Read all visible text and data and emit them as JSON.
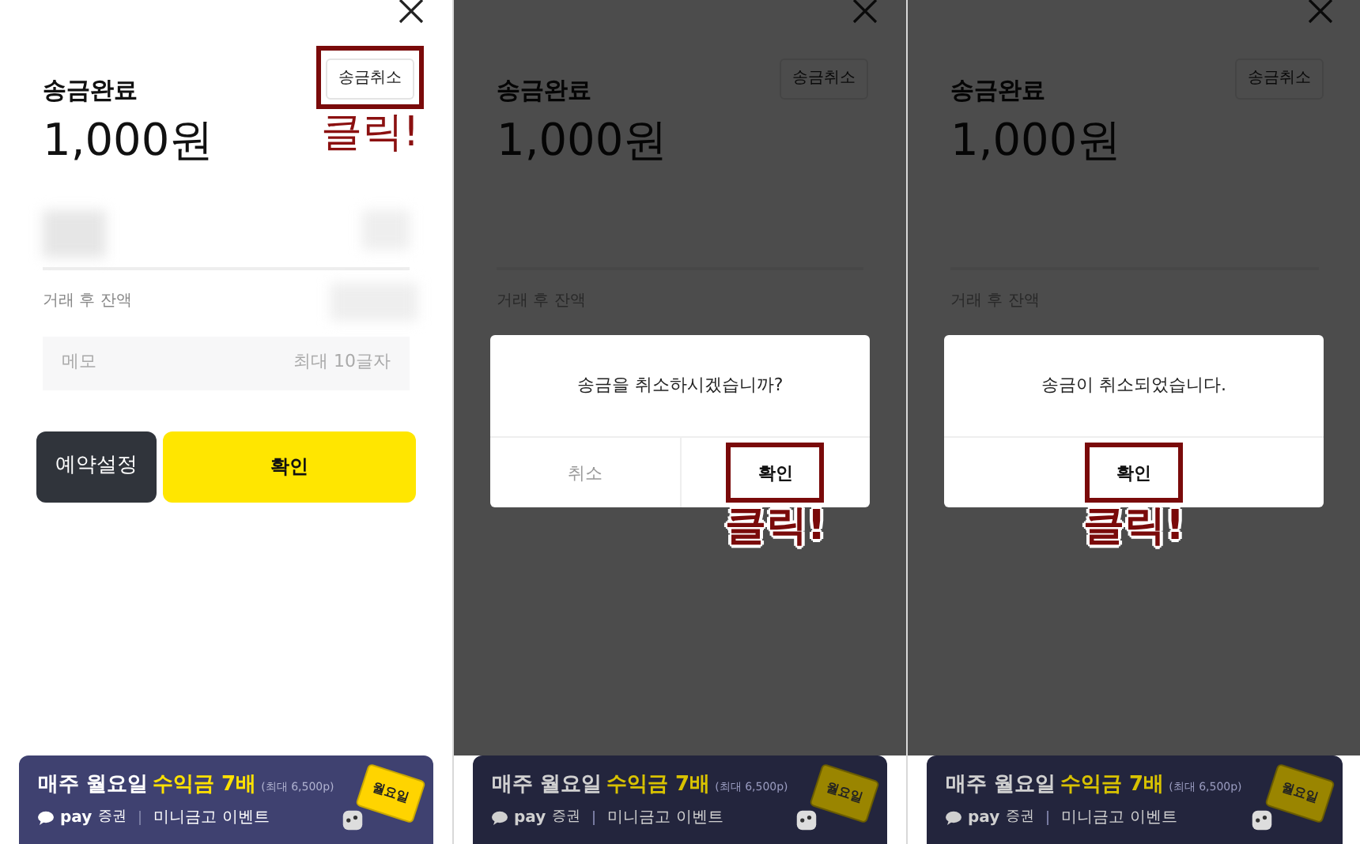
{
  "panels": [
    {
      "dimmed": false,
      "screen": {
        "title": "송금완료",
        "amount": "1,000원",
        "cancel_button": {
          "label": "송금취소",
          "highlighted": true
        },
        "balance_label": "거래 후 잔액",
        "memo": {
          "label": "메모",
          "placeholder": "최대 10글자"
        },
        "buttons": [
          {
            "kind": "secondary",
            "label": "예약설정"
          },
          {
            "kind": "primary",
            "label": "확인"
          }
        ]
      },
      "banner": {
        "headline": "매주 월요일",
        "highlight": "수익금 7배",
        "note": "(최대 6,500p)",
        "brand": "pay",
        "brand_suffix": "증권",
        "event": "미니금고 이벤트",
        "badge": "월요일"
      },
      "annotation": {
        "text": "클릭!",
        "outlined": false
      }
    },
    {
      "dimmed": true,
      "screen": {
        "title": "송금완료",
        "amount": "1,000원",
        "cancel_button": {
          "label": "송금취소",
          "highlighted": false
        },
        "balance_label": "거래 후 잔액"
      },
      "banner": {
        "headline": "매주 월요일",
        "highlight": "수익금 7배",
        "note": "(최대 6,500p)",
        "brand": "pay",
        "brand_suffix": "증권",
        "event": "미니금고 이벤트",
        "badge": "월요일"
      },
      "dialog": {
        "message": "송금을 취소하시겠습니까?",
        "buttons": [
          {
            "kind": "cancel",
            "label": "취소",
            "highlighted": false
          },
          {
            "kind": "confirm",
            "label": "확인",
            "highlighted": true
          }
        ]
      },
      "annotation": {
        "text": "클릭!",
        "outlined": true
      }
    },
    {
      "dimmed": true,
      "screen": {
        "title": "송금완료",
        "amount": "1,000원",
        "cancel_button": {
          "label": "송금취소",
          "highlighted": false
        },
        "balance_label": "거래 후 잔액"
      },
      "banner": {
        "headline": "매주 월요일",
        "highlight": "수익금 7배",
        "note": "(최대 6,500p)",
        "brand": "pay",
        "brand_suffix": "증권",
        "event": "미니금고 이벤트",
        "badge": "월요일"
      },
      "dialog": {
        "message": "송금이 취소되었습니다.",
        "buttons": [
          {
            "kind": "confirm",
            "label": "확인",
            "highlighted": true
          }
        ]
      },
      "annotation": {
        "text": "클릭!",
        "outlined": true
      }
    }
  ]
}
